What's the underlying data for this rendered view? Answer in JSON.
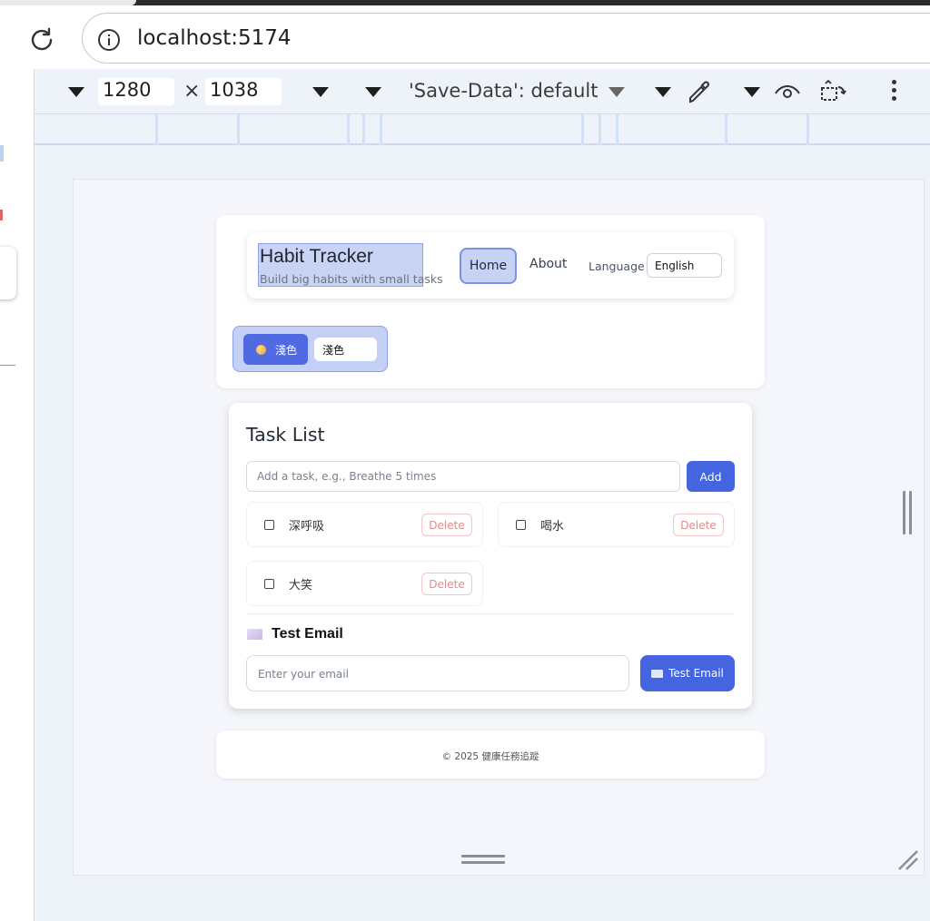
{
  "browser": {
    "url": "localhost:5174"
  },
  "devtools": {
    "width": "1280",
    "height": "1038",
    "times": "×",
    "save_data": "'Save-Data': default"
  },
  "app": {
    "title": "Habit Tracker",
    "subtitle": "Build big habits with small tasks",
    "nav": {
      "home": "Home",
      "about": "About",
      "language_label": "Language",
      "language_value": "English"
    },
    "theme": {
      "button_label": "淺色",
      "select_value": "淺色"
    },
    "tasks": {
      "heading": "Task List",
      "input_placeholder": "Add a task, e.g., Breathe 5 times",
      "add_label": "Add",
      "items": [
        {
          "name": "深呼吸",
          "delete_label": "Delete"
        },
        {
          "name": "喝水",
          "delete_label": "Delete"
        },
        {
          "name": "大笑",
          "delete_label": "Delete"
        }
      ]
    },
    "email": {
      "heading": "Test Email",
      "input_placeholder": "Enter your email",
      "button_label": "Test Email"
    },
    "footer": "© 2025 健康任務追蹤"
  },
  "colors": {
    "primary": "#4464e0",
    "highlight": "#c9d3f3",
    "delete_text": "#e38b8b",
    "page_bg": "#f4f6fb"
  }
}
